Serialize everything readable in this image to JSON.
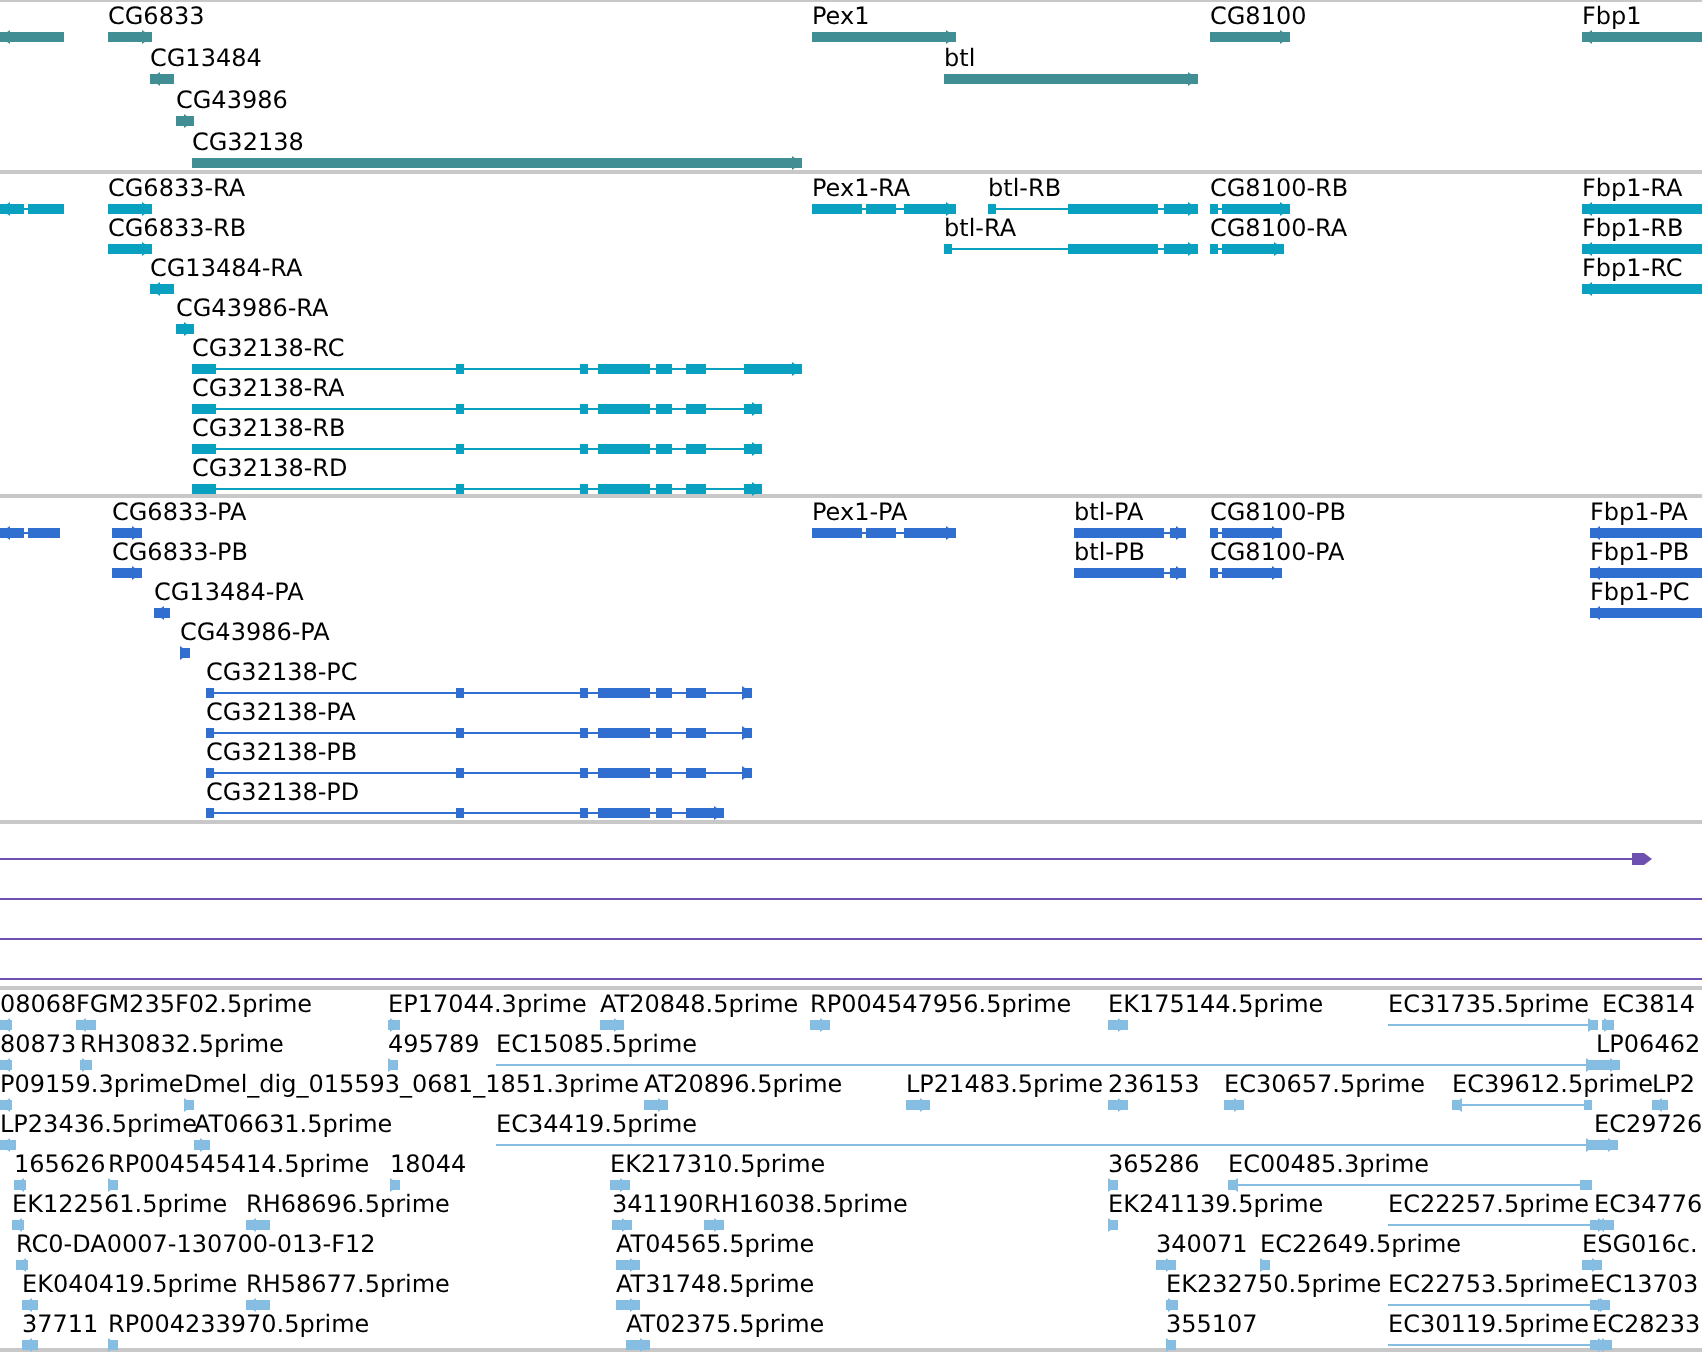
{
  "tracks": [
    {
      "kind": "gene",
      "features": [
        {
          "reverse": true
        },
        {
          "label": "CG6833",
          "reverse": false
        },
        {
          "label": "CG13484",
          "reverse": true
        },
        {
          "label": "CG43986",
          "reverse": false
        },
        {
          "label": "CG32138",
          "reverse": false
        },
        {
          "label": "Pex1",
          "reverse": false
        },
        {
          "label": "btl",
          "reverse": false
        },
        {
          "label": "CG8100",
          "reverse": false
        },
        {
          "label": "Fbp1",
          "reverse": true
        }
      ]
    },
    {
      "kind": "transcript",
      "features": [
        {
          "reverse": true
        },
        {
          "label": "CG6833-RA",
          "reverse": false
        },
        {
          "label": "CG6833-RB",
          "reverse": false
        },
        {
          "label": "CG13484-RA",
          "reverse": true
        },
        {
          "label": "CG43986-RA",
          "reverse": false
        },
        {
          "label": "CG32138-RC",
          "reverse": false
        },
        {
          "label": "CG32138-RA",
          "reverse": false
        },
        {
          "label": "CG32138-RB",
          "reverse": false
        },
        {
          "label": "CG32138-RD",
          "reverse": false
        },
        {
          "label": "Pex1-RA",
          "reverse": false
        },
        {
          "label": "btl-RB",
          "reverse": false
        },
        {
          "label": "btl-RA",
          "reverse": false
        },
        {
          "label": "CG8100-RB",
          "reverse": false
        },
        {
          "label": "CG8100-RA",
          "reverse": false
        },
        {
          "label": "Fbp1-RA",
          "reverse": true
        },
        {
          "label": "Fbp1-RB",
          "reverse": true
        },
        {
          "label": "Fbp1-RC",
          "reverse": true
        }
      ]
    },
    {
      "kind": "protein",
      "features": [
        {
          "reverse": true
        },
        {
          "label": "CG6833-PA",
          "reverse": false
        },
        {
          "label": "CG6833-PB",
          "reverse": false
        },
        {
          "label": "CG13484-PA",
          "reverse": true
        },
        {
          "label": "CG43986-PA",
          "reverse": false
        },
        {
          "label": "CG32138-PC",
          "reverse": false
        },
        {
          "label": "CG32138-PA",
          "reverse": false
        },
        {
          "label": "CG32138-PB",
          "reverse": false
        },
        {
          "label": "CG32138-PD",
          "reverse": false
        },
        {
          "label": "Pex1-PA",
          "reverse": false
        },
        {
          "label": "btl-PA",
          "reverse": false
        },
        {
          "label": "btl-PB",
          "reverse": false
        },
        {
          "label": "CG8100-PB",
          "reverse": false
        },
        {
          "label": "CG8100-PA",
          "reverse": false
        },
        {
          "label": "Fbp1-PA",
          "reverse": true
        },
        {
          "label": "Fbp1-PB",
          "reverse": true
        },
        {
          "label": "Fbp1-PC",
          "reverse": true
        }
      ]
    },
    {
      "kind": "alignment",
      "features": [
        {
          "arrowhead": true
        },
        {
          "arrowhead": false
        },
        {
          "arrowhead": false
        },
        {
          "arrowhead": false
        }
      ]
    },
    {
      "kind": "est",
      "features": [
        {
          "label": "08068",
          "reverse": true
        },
        {
          "label": "FGM235F02.5prime",
          "reverse": true
        },
        {
          "label": "EP17044.3prime",
          "reverse": false
        },
        {
          "label": "AT20848.5prime",
          "reverse": false
        },
        {
          "label": "RP004547956.5prime",
          "reverse": false
        },
        {
          "label": "EK175144.5prime",
          "reverse": false
        },
        {
          "label": "EC31735.5prime",
          "reverse": false
        },
        {
          "label": "EC3814",
          "reverse": false
        },
        {
          "label": "80873",
          "reverse": true
        },
        {
          "label": "RH30832.5prime",
          "reverse": false
        },
        {
          "label": "495789",
          "reverse": false
        },
        {
          "label": "EC15085.5prime",
          "reverse": false
        },
        {
          "label": "LP06462",
          "reverse": false
        },
        {
          "label": "P09159.3prime",
          "reverse": true
        },
        {
          "label": "Dmel_dig_015593_0681_1851.3prime",
          "reverse": false
        },
        {
          "label": "AT20896.5prime",
          "reverse": false
        },
        {
          "label": "LP21483.5prime",
          "reverse": false
        },
        {
          "label": "236153",
          "reverse": false
        },
        {
          "label": "EC30657.5prime",
          "reverse": false
        },
        {
          "label": "EC39612.5prime",
          "reverse": true
        },
        {
          "label": "LP2",
          "reverse": true
        },
        {
          "label": "LP23436.5prime",
          "reverse": true
        },
        {
          "label": "AT06631.5prime",
          "reverse": false
        },
        {
          "label": "EC34419.5prime",
          "reverse": false
        },
        {
          "label": "EC29726",
          "reverse": false
        },
        {
          "label": "165626",
          "reverse": true
        },
        {
          "label": "RP004545414.5prime",
          "reverse": false
        },
        {
          "label": "18044",
          "reverse": false
        },
        {
          "label": "EK217310.5prime",
          "reverse": false
        },
        {
          "label": "365286",
          "reverse": false
        },
        {
          "label": "EC00485.3prime",
          "reverse": true
        },
        {
          "label": "EK122561.5prime",
          "reverse": true
        },
        {
          "label": "RH68696.5prime",
          "reverse": true
        },
        {
          "label": "341190",
          "reverse": false
        },
        {
          "label": "RH16038.5prime",
          "reverse": false
        },
        {
          "label": "EK241139.5prime",
          "reverse": false
        },
        {
          "label": "EC22257.5prime",
          "reverse": false
        },
        {
          "label": "EC34776",
          "reverse": true
        },
        {
          "label": "RC0-DA0007-130700-013-F12",
          "reverse": true
        },
        {
          "label": "AT04565.5prime",
          "reverse": false
        },
        {
          "label": "340071",
          "reverse": false
        },
        {
          "label": "EC22649.5prime",
          "reverse": false
        },
        {
          "label": "ESG016c.",
          "reverse": false
        },
        {
          "label": "EK040419.5prime",
          "reverse": true
        },
        {
          "label": "RH58677.5prime",
          "reverse": true
        },
        {
          "label": "AT31748.5prime",
          "reverse": false
        },
        {
          "label": "EK232750.5prime",
          "reverse": false
        },
        {
          "label": "EC22753.5prime",
          "reverse": false
        },
        {
          "label": "EC13703",
          "reverse": false
        },
        {
          "label": "37711",
          "reverse": true
        },
        {
          "label": "RP004233970.5prime",
          "reverse": false
        },
        {
          "label": "AT02375.5prime",
          "reverse": false
        },
        {
          "label": "355107",
          "reverse": false
        },
        {
          "label": "EC30119.5prime",
          "reverse": false
        },
        {
          "label": "EC28233",
          "reverse": false
        }
      ]
    }
  ]
}
